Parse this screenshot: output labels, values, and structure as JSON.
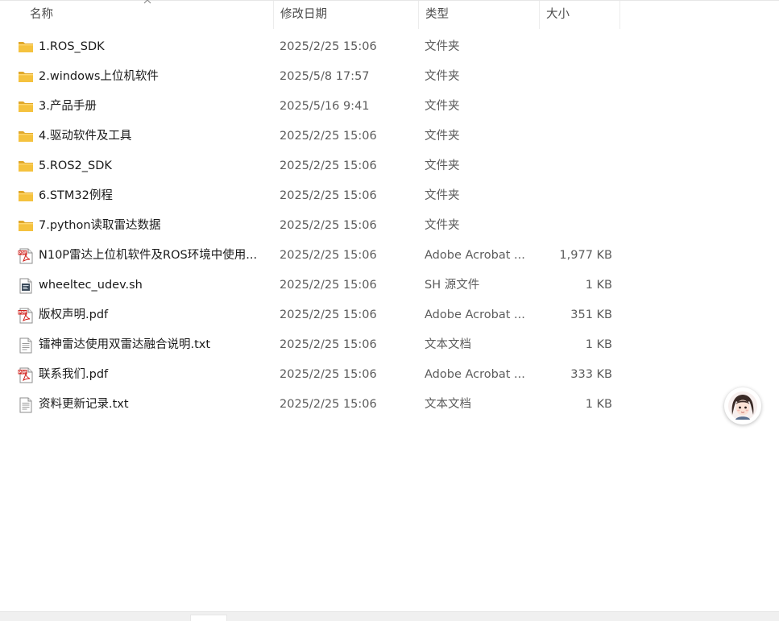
{
  "columns": {
    "name": "名称",
    "date_modified": "修改日期",
    "type": "类型",
    "size": "大小"
  },
  "files": [
    {
      "icon": "folder-icon",
      "name": "1.ROS_SDK",
      "date": "2025/2/25 15:06",
      "type": "文件夹",
      "size": ""
    },
    {
      "icon": "folder-icon",
      "name": "2.windows上位机软件",
      "date": "2025/5/8 17:57",
      "type": "文件夹",
      "size": ""
    },
    {
      "icon": "folder-icon",
      "name": "3.产品手册",
      "date": "2025/5/16 9:41",
      "type": "文件夹",
      "size": ""
    },
    {
      "icon": "folder-icon",
      "name": "4.驱动软件及工具",
      "date": "2025/2/25 15:06",
      "type": "文件夹",
      "size": ""
    },
    {
      "icon": "folder-icon",
      "name": "5.ROS2_SDK",
      "date": "2025/2/25 15:06",
      "type": "文件夹",
      "size": ""
    },
    {
      "icon": "folder-icon",
      "name": "6.STM32例程",
      "date": "2025/2/25 15:06",
      "type": "文件夹",
      "size": ""
    },
    {
      "icon": "folder-icon",
      "name": "7.python读取雷达数据",
      "date": "2025/2/25 15:06",
      "type": "文件夹",
      "size": ""
    },
    {
      "icon": "pdf-icon",
      "name": "N10P雷达上位机软件及ROS环境中使用...",
      "date": "2025/2/25 15:06",
      "type": "Adobe Acrobat ...",
      "size": "1,977 KB"
    },
    {
      "icon": "script-file-icon",
      "name": "wheeltec_udev.sh",
      "date": "2025/2/25 15:06",
      "type": "SH 源文件",
      "size": "1 KB"
    },
    {
      "icon": "pdf-icon",
      "name": "版权声明.pdf",
      "date": "2025/2/25 15:06",
      "type": "Adobe Acrobat ...",
      "size": "351 KB"
    },
    {
      "icon": "text-file-icon",
      "name": "镭神雷达使用双雷达融合说明.txt",
      "date": "2025/2/25 15:06",
      "type": "文本文档",
      "size": "1 KB"
    },
    {
      "icon": "pdf-icon",
      "name": "联系我们.pdf",
      "date": "2025/2/25 15:06",
      "type": "Adobe Acrobat ...",
      "size": "333 KB"
    },
    {
      "icon": "text-file-icon",
      "name": "资料更新记录.txt",
      "date": "2025/2/25 15:06",
      "type": "文本文档",
      "size": "1 KB"
    }
  ],
  "colors": {
    "folder": "#f5c23e",
    "folder_dark": "#e0a82a",
    "pdf_red": "#d0201b",
    "text_secondary": "#5c5c5c"
  },
  "sort": {
    "column": "name",
    "direction": "ascending"
  },
  "assistant": {
    "icon": "assistant-avatar-icon"
  }
}
